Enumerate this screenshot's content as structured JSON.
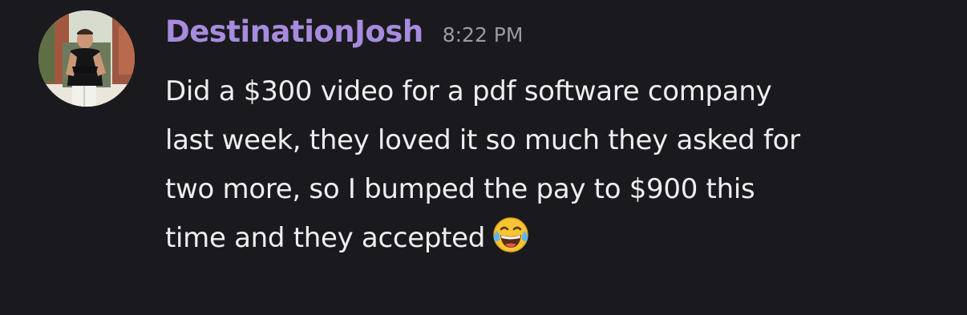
{
  "message": {
    "author": {
      "username": "DestinationJosh",
      "avatar": "profile-photo",
      "name_color": "#a78bde"
    },
    "timestamp": "8:22 PM",
    "content_lines": [
      "Did a $300 video for a pdf software company",
      "last week, they loved it so much they asked for",
      "two more, so I bumped the pay to $900 this",
      "time and they accepted"
    ],
    "emoji": {
      "name": "face-with-tears-of-joy-icon",
      "char": "😂"
    }
  },
  "theme": {
    "background": "#1a1a1e",
    "text": "#eeeef0",
    "muted": "#9a9aa2"
  }
}
